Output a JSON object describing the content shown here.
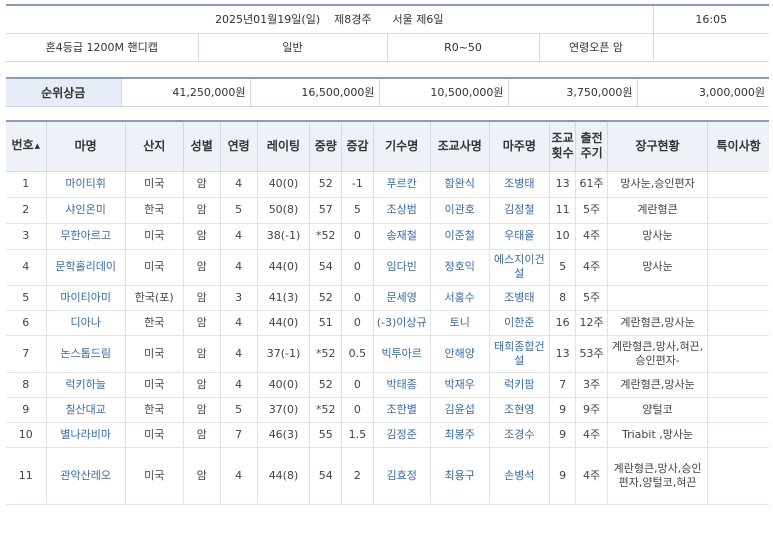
{
  "race": {
    "date": "2025년01월19일(일)",
    "race_no": "제8경주",
    "venue": "서울 제6일",
    "time": "16:05",
    "grade_distance": "혼4등급 1200M 핸디캡",
    "type": "일반",
    "rating_range": "R0~50",
    "age_sex": "연령오픈 암"
  },
  "prize": {
    "label": "순위상금",
    "values": [
      "41,250,000원",
      "16,500,000원",
      "10,500,000원",
      "3,750,000원",
      "3,000,000원"
    ]
  },
  "table": {
    "headers": {
      "no": "번호",
      "sort_mark": "▲",
      "horse": "마명",
      "origin": "산지",
      "sex": "성별",
      "age": "연령",
      "rating": "레이팅",
      "weight": "중량",
      "weight_change": "증감",
      "jockey": "기수명",
      "trainer": "조교사명",
      "owner": "마주명",
      "train_count_1": "조교",
      "train_count_2": "횟수",
      "period_1": "출전",
      "period_2": "주기",
      "equipment": "장구현황",
      "notes": "특이사항"
    },
    "rows": [
      {
        "no": "1",
        "horse": "마이티휘",
        "origin": "미국",
        "sex": "암",
        "age": "4",
        "rating": "40(0)",
        "weight": "52",
        "change": "-1",
        "jockey": "푸르칸",
        "trainer": "함완식",
        "owner": "조병태",
        "count": "13",
        "period": "61주",
        "equipment": "망사눈,승인편자",
        "notes": ""
      },
      {
        "no": "2",
        "horse": "샤인온미",
        "origin": "한국",
        "sex": "암",
        "age": "5",
        "rating": "50(8)",
        "weight": "57",
        "change": "5",
        "jockey": "조상범",
        "trainer": "이관호",
        "owner": "김정철",
        "count": "11",
        "period": "5주",
        "equipment": "계란형큰",
        "notes": ""
      },
      {
        "no": "3",
        "horse": "무한아르고",
        "origin": "미국",
        "sex": "암",
        "age": "4",
        "rating": "38(-1)",
        "weight": "*52",
        "change": "0",
        "jockey": "송재철",
        "trainer": "이준철",
        "owner": "우태율",
        "count": "10",
        "period": "4주",
        "equipment": "망사눈",
        "notes": ""
      },
      {
        "no": "4",
        "horse": "문학홀리데이",
        "origin": "미국",
        "sex": "암",
        "age": "4",
        "rating": "44(0)",
        "weight": "54",
        "change": "0",
        "jockey": "임다빈",
        "trainer": "정호익",
        "owner": "에스지이건설",
        "count": "5",
        "period": "4주",
        "equipment": "망사눈",
        "notes": ""
      },
      {
        "no": "5",
        "horse": "마이티아미",
        "origin": "한국(포)",
        "sex": "암",
        "age": "3",
        "rating": "41(3)",
        "weight": "52",
        "change": "0",
        "jockey": "문세영",
        "trainer": "서홍수",
        "owner": "조병태",
        "count": "8",
        "period": "5주",
        "equipment": "",
        "notes": ""
      },
      {
        "no": "6",
        "horse": "디아나",
        "origin": "한국",
        "sex": "암",
        "age": "4",
        "rating": "44(0)",
        "weight": "51",
        "change": "0",
        "jockey": "(-3)이상규",
        "trainer": "토니",
        "owner": "이한준",
        "count": "16",
        "period": "12주",
        "equipment": "계란형큰,망사눈",
        "notes": ""
      },
      {
        "no": "7",
        "horse": "논스톱드림",
        "origin": "미국",
        "sex": "암",
        "age": "4",
        "rating": "37(-1)",
        "weight": "*52",
        "change": "0.5",
        "jockey": "빅투아르",
        "trainer": "안해양",
        "owner": "태희종합건설",
        "count": "13",
        "period": "53주",
        "equipment": "계란형큰,망사,혀끈,승인편자-",
        "notes": ""
      },
      {
        "no": "8",
        "horse": "럭키하늘",
        "origin": "미국",
        "sex": "암",
        "age": "4",
        "rating": "40(0)",
        "weight": "52",
        "change": "0",
        "jockey": "박태종",
        "trainer": "박재우",
        "owner": "럭키팜",
        "count": "7",
        "period": "3주",
        "equipment": "계란형큰,망사눈",
        "notes": ""
      },
      {
        "no": "9",
        "horse": "칠산대교",
        "origin": "한국",
        "sex": "암",
        "age": "5",
        "rating": "37(0)",
        "weight": "*52",
        "change": "0",
        "jockey": "조한별",
        "trainer": "김윤섭",
        "owner": "조현영",
        "count": "9",
        "period": "9주",
        "equipment": "양털코",
        "notes": ""
      },
      {
        "no": "10",
        "horse": "별나라비마",
        "origin": "미국",
        "sex": "암",
        "age": "7",
        "rating": "46(3)",
        "weight": "55",
        "change": "1.5",
        "jockey": "김정준",
        "trainer": "최봉주",
        "owner": "조경수",
        "count": "9",
        "period": "4주",
        "equipment": "Triabit ,망사눈",
        "notes": ""
      },
      {
        "no": "11",
        "horse": "관악산레오",
        "origin": "미국",
        "sex": "암",
        "age": "4",
        "rating": "44(8)",
        "weight": "54",
        "change": "2",
        "jockey": "김효정",
        "trainer": "최용구",
        "owner": "손병석",
        "count": "9",
        "period": "4주",
        "equipment": "계란형큰,망사,승인편자,양털코,혀끈",
        "notes": ""
      }
    ]
  }
}
